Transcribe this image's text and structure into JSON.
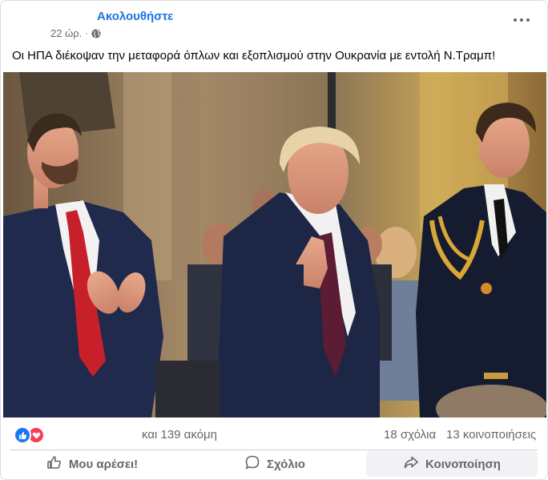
{
  "header": {
    "follow_label": "Ακολουθήστε",
    "timestamp": "22 ώρ.",
    "separator": "·",
    "audience_icon": "globe-icon",
    "more_icon": "more-options-icon"
  },
  "post": {
    "text": "Οι ΗΠΑ διέκοψαν την μεταφορά όπλων και εξοπλισμού στην Ουκρανία με εντολή Ν.Τραμπ!"
  },
  "reactions": {
    "icons": [
      "like-icon",
      "love-icon"
    ],
    "count_text": "και 139 ακόμη",
    "comments_text": "18 σχόλια",
    "shares_text": "13 κοινοποιήσεις"
  },
  "actions": {
    "like_label": "Μου αρέσει!",
    "comment_label": "Σχόλιο",
    "share_label": "Κοινοποίηση"
  },
  "colors": {
    "accent": "#1b74e4",
    "like_blue": "#1877f2",
    "love_red": "#f33e58",
    "secondary_text": "#65676b"
  }
}
